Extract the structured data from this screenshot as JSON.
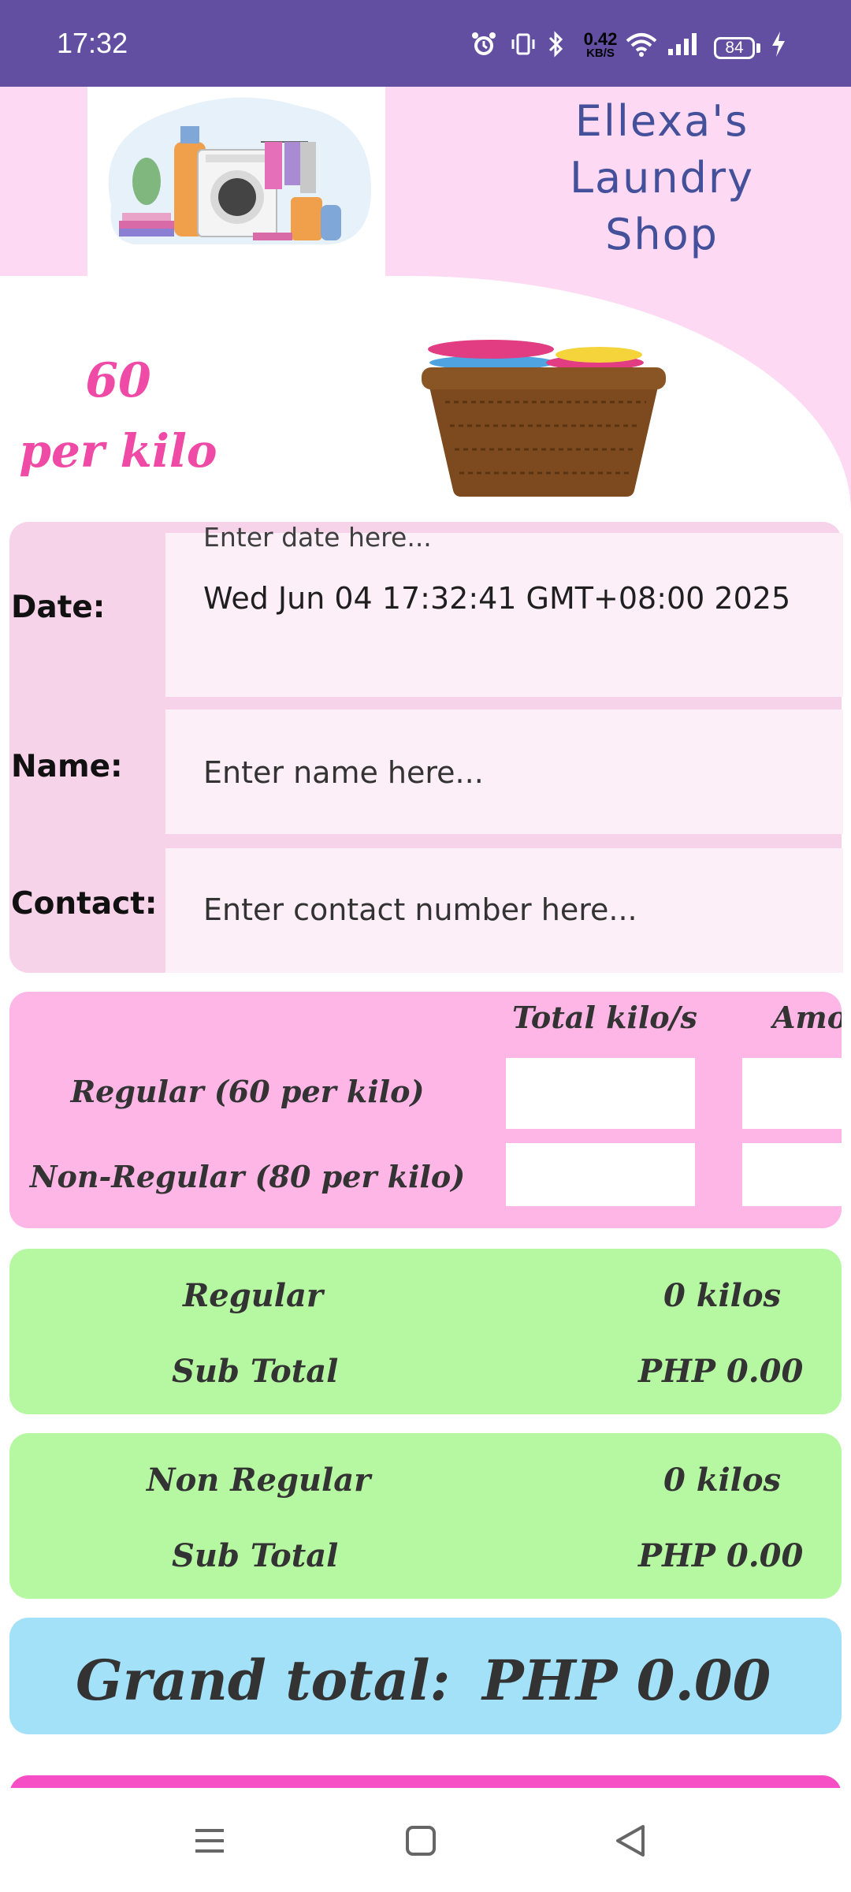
{
  "status_bar": {
    "time": "17:32",
    "net_speed": "0.42",
    "net_unit": "KB/S",
    "battery": "84",
    "icons": [
      "alarm-icon",
      "vibrate-icon",
      "bluetooth-icon",
      "wifi-icon",
      "signal-icon",
      "charging-icon"
    ]
  },
  "header": {
    "shop_name_line1": "Ellexa's",
    "shop_name_line2": "Laundry",
    "shop_name_line3": "Shop"
  },
  "price": {
    "value": "60",
    "unit": "per kilo"
  },
  "form": {
    "date_label": "Date:",
    "date_hint": "Enter date here...",
    "date_value": "Wed Jun 04 17:32:41 GMT+08:00 2025",
    "name_label": "Name:",
    "name_placeholder": "Enter name here...",
    "contact_label": "Contact:",
    "contact_placeholder": "Enter contact number here..."
  },
  "kilo_table": {
    "col_total": "Total kilo/s",
    "col_amount": "Amo",
    "regular_label": "Regular (60 per kilo)",
    "nonregular_label": "Non-Regular (80 per kilo)"
  },
  "regular_summary": {
    "title": "Regular",
    "kilos": "0 kilos",
    "subtotal_label": "Sub Total",
    "subtotal_value": "PHP 0.00"
  },
  "nonregular_summary": {
    "title": "Non Regular",
    "kilos": "0 kilos",
    "subtotal_label": "Sub Total",
    "subtotal_value": "PHP 0.00"
  },
  "grand_total": {
    "label": "Grand total:",
    "value": "PHP 0.00"
  },
  "colors": {
    "status_bar": "#634fa1",
    "header_pink": "#fdd9f4",
    "accent_pink": "#ee4aa6",
    "kilo_card": "#fdb6e6",
    "summary_green": "#b6f8a1",
    "grand_blue": "#a3e1f8"
  }
}
